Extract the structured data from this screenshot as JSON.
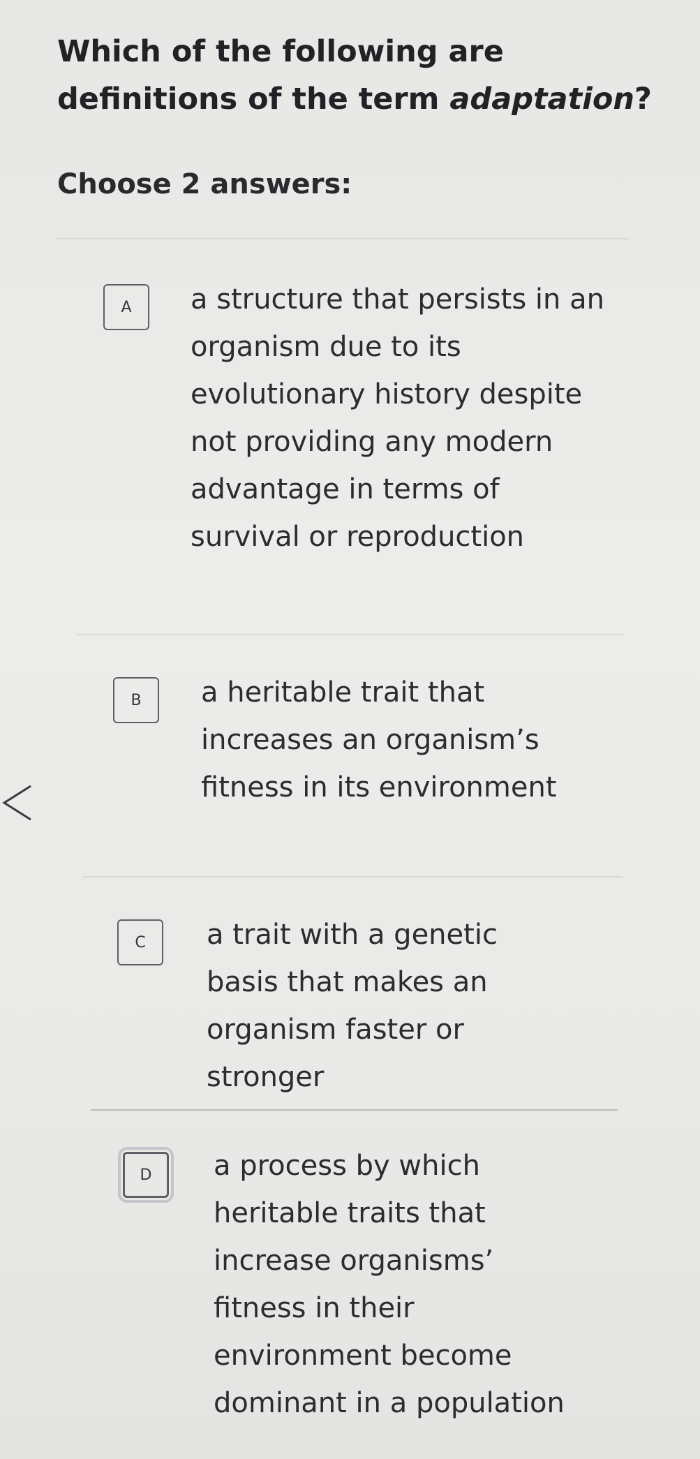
{
  "question": {
    "prefix": "Which of the following are definitions of the term ",
    "term": "adaptation",
    "suffix": "?"
  },
  "instructions": "Choose 2 answers:",
  "choices": [
    {
      "letter": "A",
      "text": "a structure that persists in an organism due to its evolutionary history despite not providing any modern advantage in terms of survival or reproduction"
    },
    {
      "letter": "B",
      "text": "a heritable trait that increases an organism’s fitness in its environment"
    },
    {
      "letter": "C",
      "text": "a trait with a genetic basis that makes an organism faster or stronger"
    },
    {
      "letter": "D",
      "text": "a process by which heritable traits that increase organisms’ fitness in their environment become dominant in a population"
    }
  ],
  "icons": {
    "back": "chevron-left-icon"
  }
}
